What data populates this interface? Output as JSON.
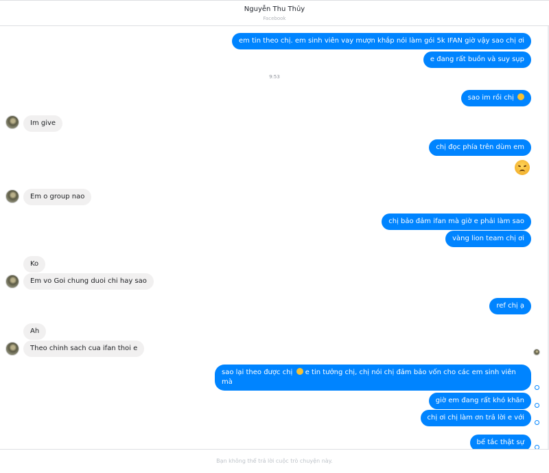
{
  "header": {
    "name": "Nguyễn Thu Thủy",
    "subtitle": "Facebook"
  },
  "time_divider": "9:53",
  "messages": [
    {
      "dir": "out",
      "text": "em tin theo chị. em sinh viên vay mượn khắp nói làm gói 5k IFAN giờ vậy sao chị ơi"
    },
    {
      "dir": "out",
      "text": "e đang rất buồn và suy sụp"
    },
    {
      "dir": "out",
      "text": "sao im rồi chị",
      "emoji": "sad-face"
    },
    {
      "dir": "in",
      "text": "Im give"
    },
    {
      "dir": "out",
      "text": "chị đọc phía trên dùm em"
    },
    {
      "dir": "out",
      "emoji": "sad-face"
    },
    {
      "dir": "in",
      "text": "Em o group nao"
    },
    {
      "dir": "out",
      "text": "chị bảo đảm ifan mà giờ e phải làm sao"
    },
    {
      "dir": "out",
      "text": "vàng lion team chị ơi"
    },
    {
      "dir": "in",
      "text": "Ko"
    },
    {
      "dir": "in",
      "text": "Em vo Goi chung duoi chi hay sao"
    },
    {
      "dir": "out",
      "text": "ref chị ạ"
    },
    {
      "dir": "in",
      "text": "Ah"
    },
    {
      "dir": "in",
      "text": "Theo chinh sach cua ifan thoi e"
    },
    {
      "dir": "out",
      "text_a": "sao lại theo được chị",
      "text_b": "e tin tưởng chị, chị nói chị đảm bảo vốn cho các em sinh viên mà",
      "emoji": "sad-face"
    },
    {
      "dir": "out",
      "text": "giờ em đang rất khó khăn"
    },
    {
      "dir": "out",
      "text": "chị ơi chị làm ơn trả lời e với"
    },
    {
      "dir": "out",
      "text": "bế tắc thật sự"
    }
  ],
  "footer": {
    "notice": "Bạn không thể trả lời cuộc trò chuyện này."
  },
  "colors": {
    "outgoing": "#0084ff",
    "incoming": "#f1f0f0"
  }
}
